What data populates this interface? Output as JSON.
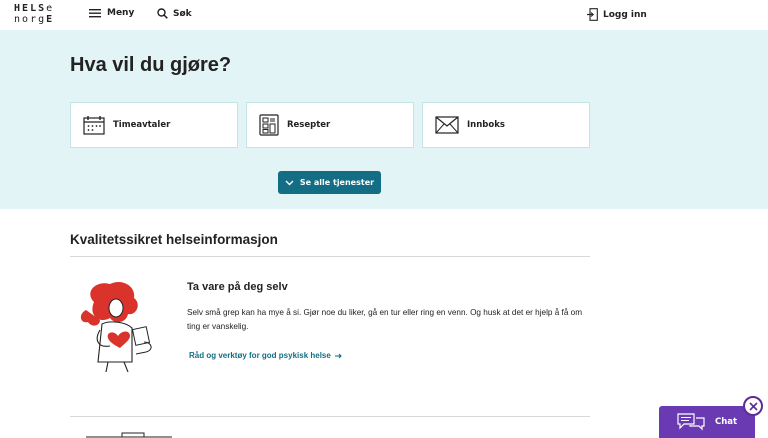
{
  "header": {
    "logo_top": [
      "H",
      "E",
      "L",
      "S",
      "e"
    ],
    "logo_bottom": [
      "n",
      "o",
      "r",
      "g",
      "E"
    ],
    "menu_label": "Meny",
    "search_label": "Søk",
    "login_label": "Logg inn"
  },
  "hero": {
    "title": "Hva vil du gjøre?",
    "cards": [
      {
        "label": "Timeavtaler",
        "icon": "calendar-icon"
      },
      {
        "label": "Resepter",
        "icon": "prescription-icon"
      },
      {
        "label": "Innboks",
        "icon": "envelope-icon"
      }
    ],
    "see_all_label": "Se alle tjenester"
  },
  "section": {
    "title": "Kvalitetssikret helseinformasjon",
    "article": {
      "title": "Ta vare på deg selv",
      "text": "Selv små grep kan ha mye å si. Gjør noe du liker, gå en tur eller ring en venn. Og husk at det er hjelp å få om ting er vanskelig.",
      "link": "Råd og verktøy for god psykisk helse"
    }
  },
  "chat": {
    "label": "Chat"
  },
  "colors": {
    "hero_bg": "#e3f4f6",
    "primary": "#136e85",
    "chat": "#6a3ab2"
  }
}
